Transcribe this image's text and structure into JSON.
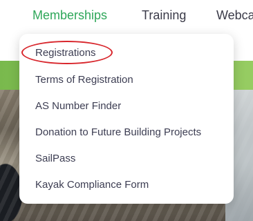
{
  "nav": {
    "items": [
      {
        "label": "Memberships",
        "active": true
      },
      {
        "label": "Training",
        "active": false
      },
      {
        "label": "Webca",
        "active": false
      }
    ],
    "active_color": "#2fa75a"
  },
  "dropdown": {
    "items": [
      {
        "label": "Registrations"
      },
      {
        "label": "Terms of Registration"
      },
      {
        "label": "AS Number Finder"
      },
      {
        "label": "Donation to Future Building Projects"
      },
      {
        "label": "SailPass"
      },
      {
        "label": "Kayak Compliance Form"
      }
    ]
  },
  "annotation": {
    "color": "#d8262c",
    "target": "Registrations"
  }
}
